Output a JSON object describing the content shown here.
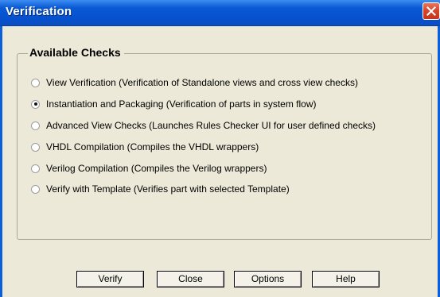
{
  "window": {
    "title": "Verification"
  },
  "group": {
    "label": "Available Checks"
  },
  "options": [
    {
      "label": "View Verification (Verification of Standalone views and cross view checks)",
      "selected": false
    },
    {
      "label": "Instantiation and Packaging (Verification of parts in system flow)",
      "selected": true
    },
    {
      "label": "Advanced View Checks (Launches Rules Checker UI for user defined checks)",
      "selected": false
    },
    {
      "label": "VHDL Compilation (Compiles the VHDL wrappers)",
      "selected": false
    },
    {
      "label": "Verilog Compilation (Compiles the Verilog wrappers)",
      "selected": false
    },
    {
      "label": "Verify with Template (Verifies part with selected Template)",
      "selected": false
    }
  ],
  "buttons": {
    "verify": "Verify",
    "close": "Close",
    "options": "Options",
    "help": "Help"
  },
  "colors": {
    "titlebar": "#0a5ad4",
    "dialog_bg": "#ece9d8",
    "close_button": "#d9452a"
  },
  "icons": {
    "close": "close-x-icon"
  }
}
